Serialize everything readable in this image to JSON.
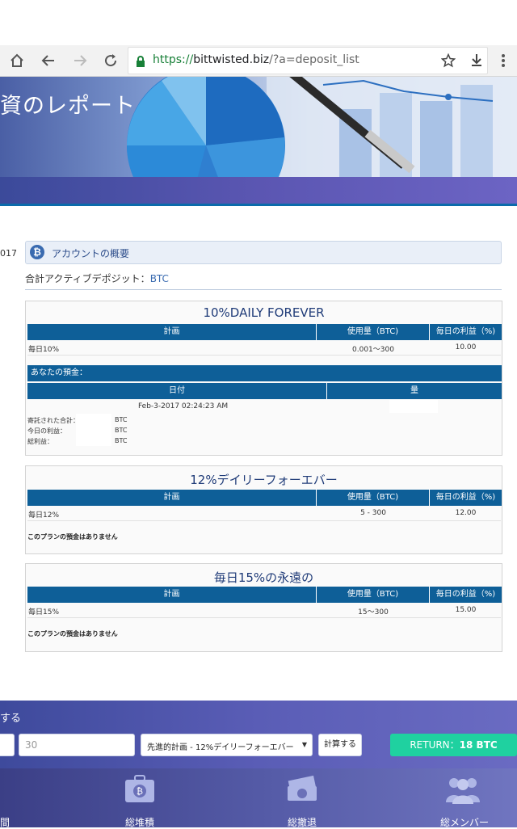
{
  "browser": {
    "url_scheme": "https://",
    "url_domain": "bittwisted.biz",
    "url_path": "/?a=deposit_list"
  },
  "hero": {
    "title": "資のレポート"
  },
  "left_edge_year": "017",
  "account": {
    "title": "アカウントの概要",
    "active_label": "合計アクティブデポジット：",
    "active_unit": "BTC"
  },
  "columns": {
    "plan": "計画",
    "amount": "使用量（BTC)",
    "profit": "毎日の利益（%)"
  },
  "plans": [
    {
      "title": "10%DAILY FOREVER",
      "row": {
        "name": "毎日10%",
        "range": "0.001〜300",
        "profit": "10.00"
      },
      "deposits": {
        "header": "あなたの預金：",
        "date_col": "日付",
        "amount_col": "量",
        "date": "Feb-3-2017 02:24:23 AM",
        "summary": [
          {
            "label": "寄託された合計：",
            "unit": "BTC"
          },
          {
            "label": "今日の利益：",
            "unit": "BTC"
          },
          {
            "label": "総利益：",
            "unit": "BTC"
          }
        ]
      }
    },
    {
      "title": "12%デイリーフォーエバー",
      "row": {
        "name": "毎日12%",
        "range": "5 - 300",
        "profit": "12.00"
      },
      "empty_text": "このプランの預金はありません"
    },
    {
      "title": "毎日15%の永遠の",
      "row": {
        "name": "毎日15%",
        "range": "15〜300",
        "profit": "15.00"
      },
      "empty_text": "このプランの預金はありません"
    }
  ],
  "calculator": {
    "title": "する",
    "amount_value": "30",
    "plan_select": "先進的計画 - 12%デイリーフォーエバー",
    "calc_button": "計算する",
    "return_label": "RETURN：",
    "return_value": "18 BTC"
  },
  "stats": [
    {
      "label": "間",
      "icon": "clock-icon"
    },
    {
      "label": "総堆積",
      "icon": "bitcoin-safe-icon"
    },
    {
      "label": "総撤退",
      "icon": "money-stack-icon"
    },
    {
      "label": "総メンバー",
      "icon": "users-icon"
    }
  ]
}
